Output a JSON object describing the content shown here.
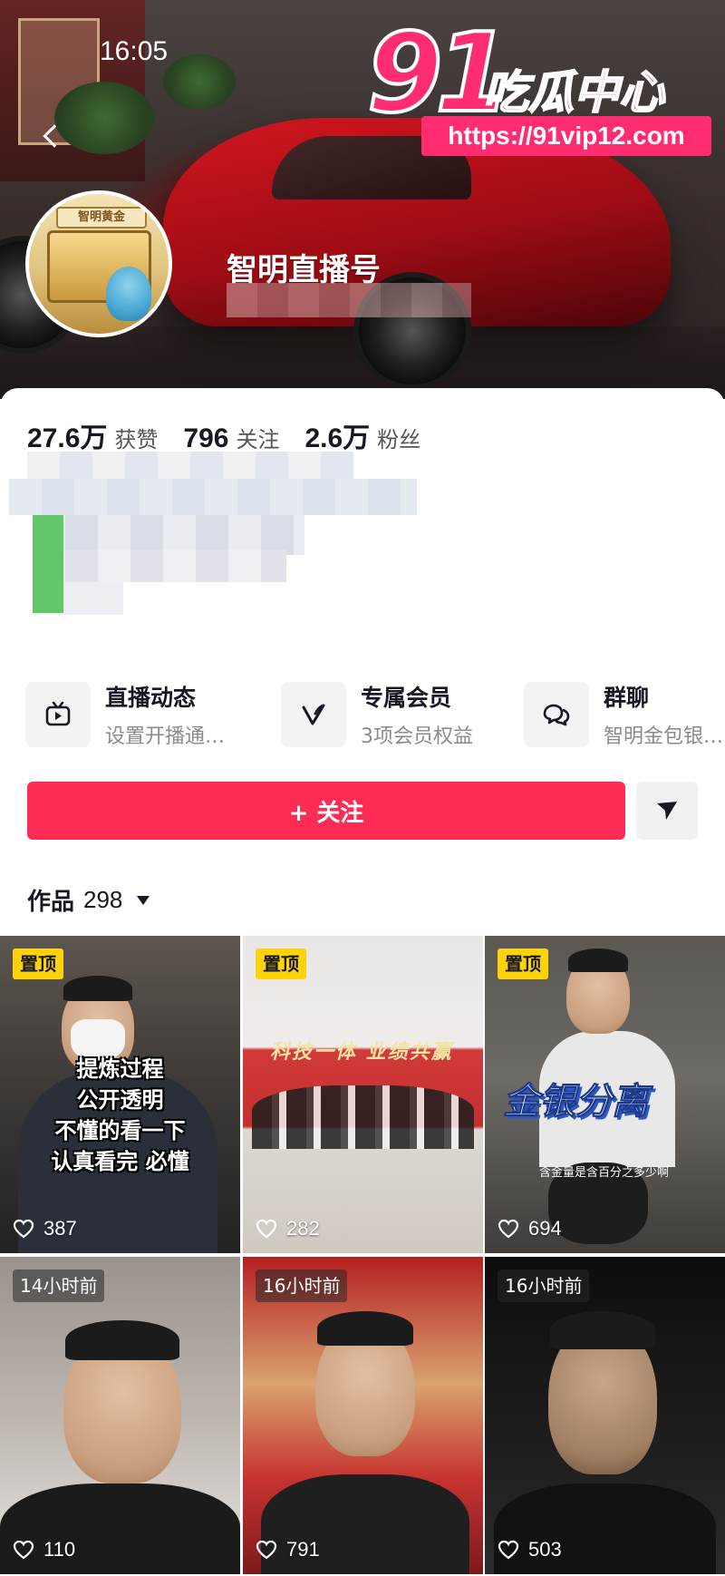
{
  "status_bar": {
    "time": "16:05"
  },
  "watermark": {
    "number": "91",
    "text": "吃瓜中心",
    "url": "https://91vip12.com"
  },
  "avatar": {
    "sign_text": "智明黄金"
  },
  "profile": {
    "name": "智明直播号",
    "stats": [
      {
        "value": "27.6万",
        "label": "获赞"
      },
      {
        "value": "796",
        "label": "关注"
      },
      {
        "value": "2.6万",
        "label": "粉丝"
      }
    ]
  },
  "features": [
    {
      "title": "直播动态",
      "subtitle": "设置开播通…",
      "icon": "tv-icon"
    },
    {
      "title": "专属会员",
      "subtitle": "3项会员权益",
      "icon": "member-v-icon"
    },
    {
      "title": "群聊",
      "subtitle": "智明金包银…",
      "icon": "chat-icon"
    }
  ],
  "actions": {
    "follow_label": "+ 关注",
    "share_icon": "send-icon"
  },
  "works": {
    "label": "作品",
    "count": "298"
  },
  "videos": [
    {
      "tag": "置顶",
      "likes": "387",
      "caption_lines": [
        "提炼过程",
        "公开透明",
        "不懂的看一下",
        "认真看完 必懂"
      ]
    },
    {
      "tag": "置顶",
      "likes": "282",
      "banner": "科技一体 业绩共赢"
    },
    {
      "tag": "置顶",
      "likes": "694",
      "caption": "金银分离",
      "subtitle": "含金量是含百分之多少啊"
    },
    {
      "time": "14小时前",
      "likes": "110"
    },
    {
      "time": "16小时前",
      "likes": "791"
    },
    {
      "time": "16小时前",
      "likes": "503"
    }
  ],
  "colors": {
    "accent": "#fe2c55",
    "pin_tag": "#ffd20a",
    "watermark": "#ff2d6f"
  }
}
